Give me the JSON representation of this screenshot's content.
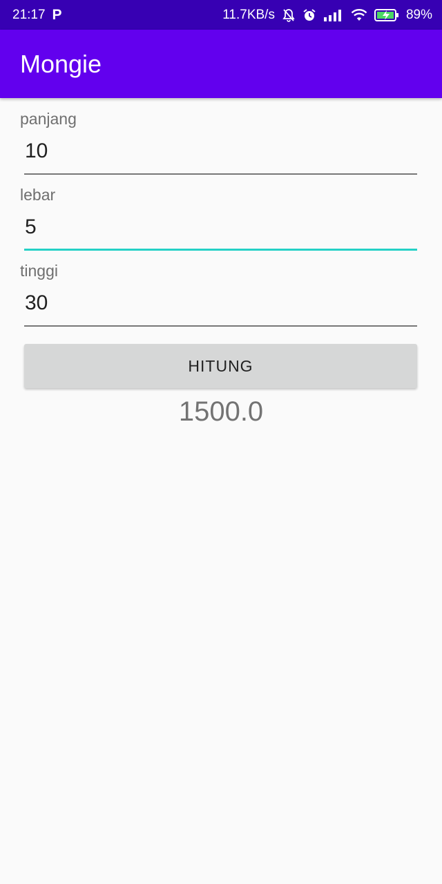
{
  "statusbar": {
    "time": "21:17",
    "app_icon": "P",
    "net_speed": "11.7KB/s",
    "battery": "89%",
    "icons": [
      "silent-bell-icon",
      "alarm-icon",
      "signal-icon",
      "wifi-icon",
      "battery-charging-icon"
    ]
  },
  "appbar": {
    "title": "Mongie"
  },
  "form": {
    "panjang": {
      "label": "panjang",
      "value": "10"
    },
    "lebar": {
      "label": "lebar",
      "value": "5"
    },
    "tinggi": {
      "label": "tinggi",
      "value": "30"
    },
    "button_label": "HITUNG"
  },
  "result": "1500.0",
  "colors": {
    "statusbar": "#3700b3",
    "appbar": "#6200ee",
    "focus_accent": "#25d1c6",
    "button": "#d6d7d7"
  }
}
